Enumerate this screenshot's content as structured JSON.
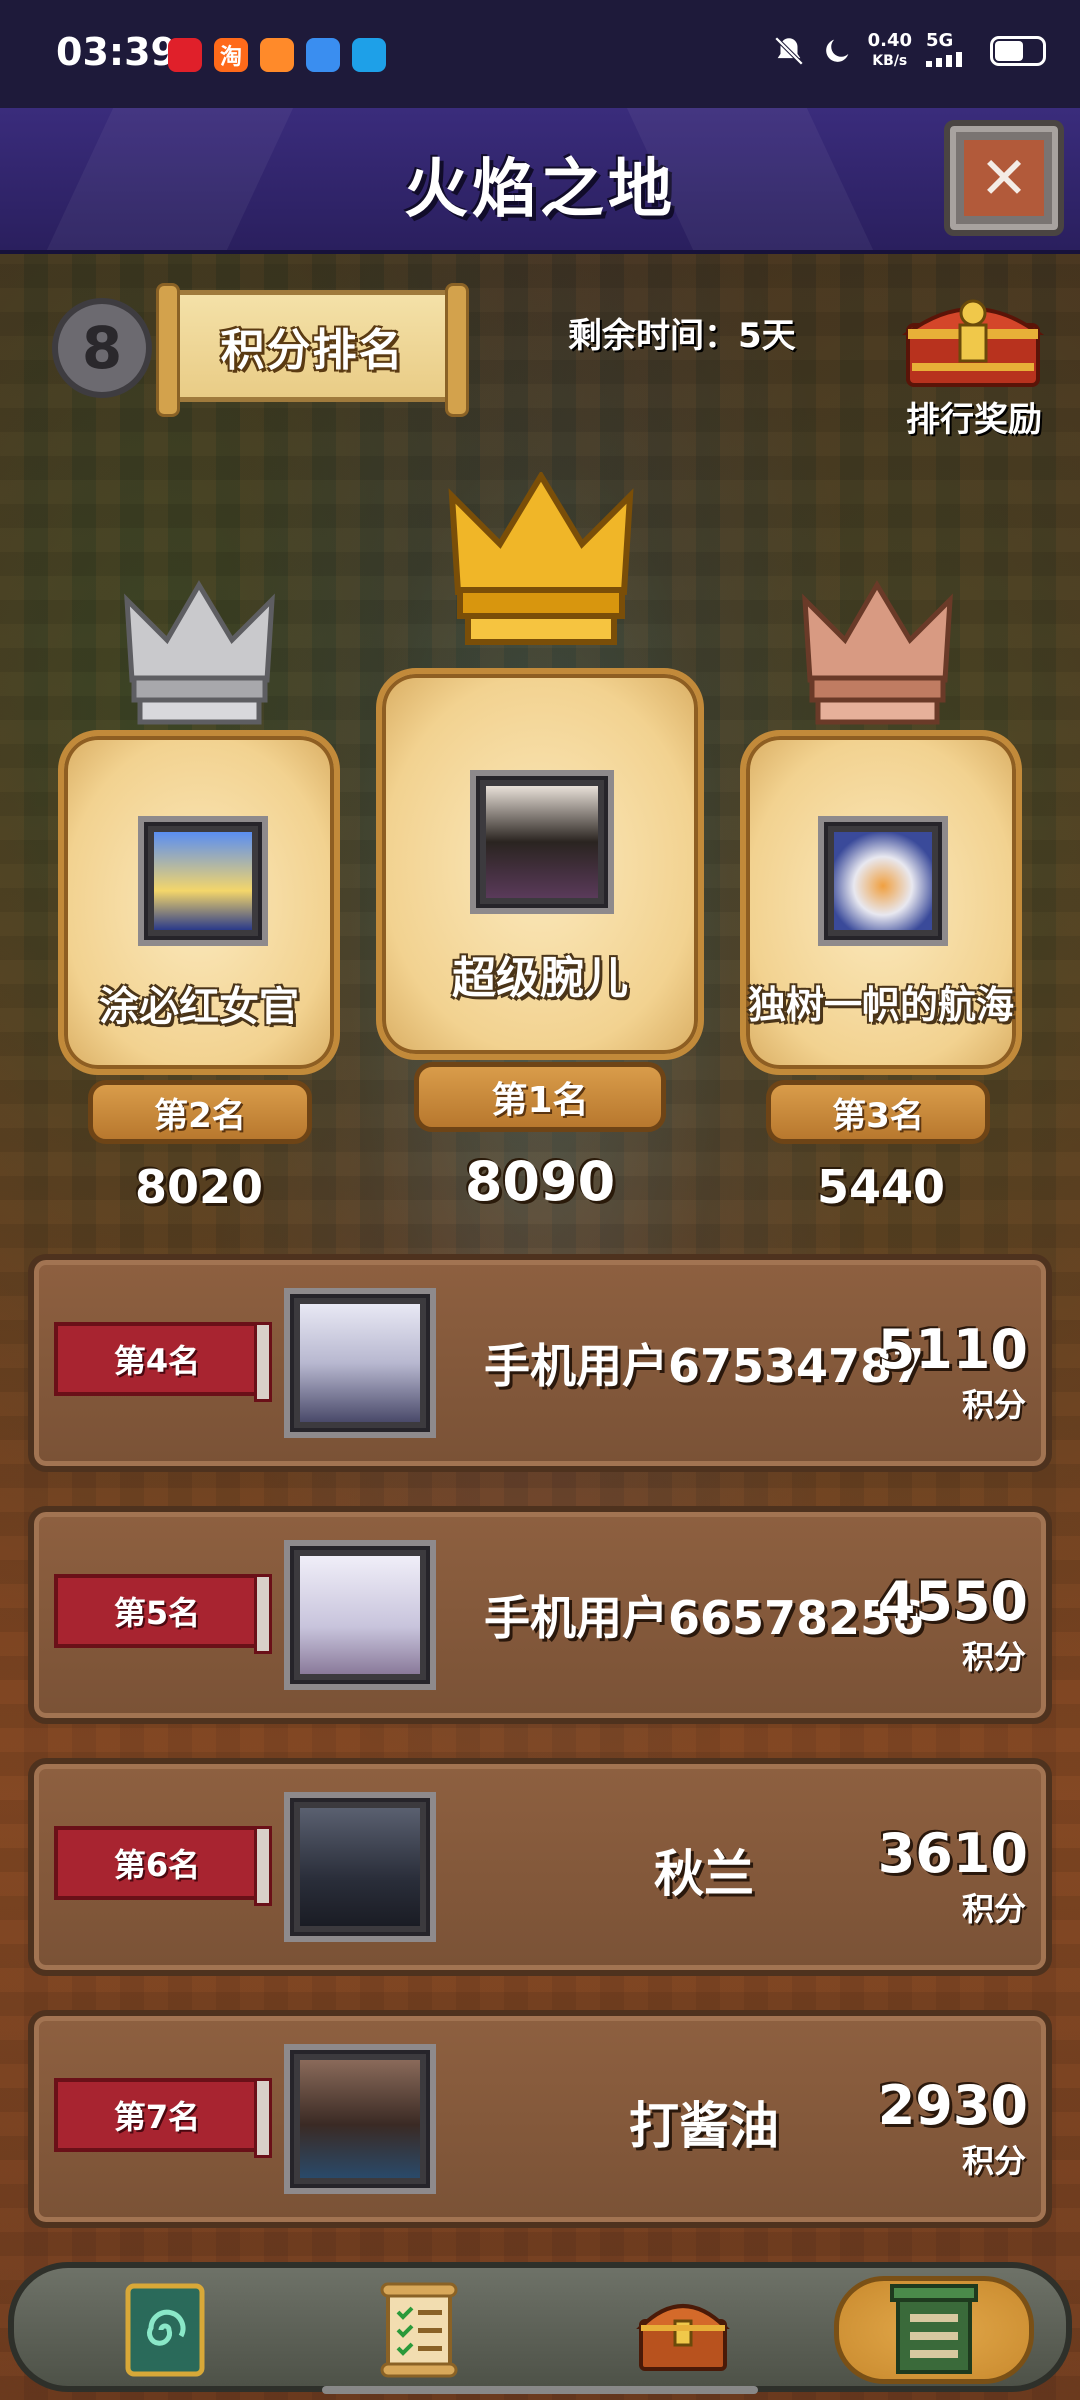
{
  "status_bar": {
    "time": "03:39",
    "net_speed_value": "0.40",
    "net_speed_unit": "KB/s",
    "network": "5G",
    "app_icons": [
      "app-icon-red",
      "taobao-icon",
      "orange-app-icon",
      "file-app-icon",
      "blue-app-icon"
    ],
    "app_icon_labels": [
      "",
      "淘",
      "",
      "",
      ""
    ]
  },
  "header": {
    "title": "火焰之地",
    "close_symbol": "✕"
  },
  "top_bar": {
    "season_number": "8",
    "ranking_button_label": "积分排名",
    "remaining_time": "剩余时间：5天",
    "reward_label": "排行奖励"
  },
  "podium": {
    "first": {
      "name": "超级腕儿",
      "rank_label": "第1名",
      "score": "8090"
    },
    "second": {
      "name": "涂必红女官",
      "rank_label": "第2名",
      "score": "8020"
    },
    "third": {
      "name": "独树一帜的航海",
      "rank_label": "第3名",
      "score": "5440"
    }
  },
  "ranking_list": [
    {
      "rank_label": "第4名",
      "name": "手机用户67534787",
      "score": "5110",
      "unit": "积分"
    },
    {
      "rank_label": "第5名",
      "name": "手机用户66578256",
      "score": "4550",
      "unit": "积分"
    },
    {
      "rank_label": "第6名",
      "name": "秋兰",
      "score": "3610",
      "unit": "积分"
    },
    {
      "rank_label": "第7名",
      "name": "打酱油",
      "score": "2930",
      "unit": "积分"
    }
  ],
  "bottom_nav": {
    "items": [
      "card-spiral-icon",
      "checklist-scroll-icon",
      "treasure-chest-icon",
      "ranking-board-icon"
    ],
    "active_index": 3
  },
  "colors": {
    "title_bar": "#2a1f5e",
    "rank_badge_red": "#a82430",
    "row_brown": "#8e6040",
    "gold": "#f2d290"
  }
}
